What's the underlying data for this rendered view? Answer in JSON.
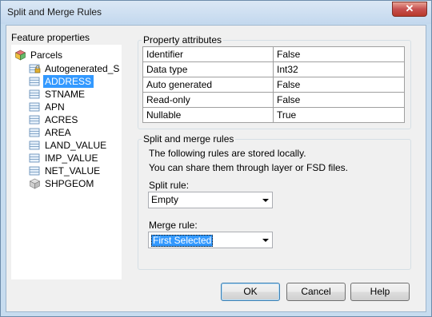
{
  "window": {
    "title": "Split and Merge Rules",
    "close_glyph": "✕"
  },
  "feature_properties": {
    "label": "Feature properties",
    "root": {
      "label": "Parcels",
      "icon": "feature-class-icon"
    },
    "fields": [
      {
        "label": "Autogenerated_S",
        "icon": "locked-field-icon",
        "selected": false
      },
      {
        "label": "ADDRESS",
        "icon": "field-icon",
        "selected": true
      },
      {
        "label": "STNAME",
        "icon": "field-icon",
        "selected": false
      },
      {
        "label": "APN",
        "icon": "field-icon",
        "selected": false
      },
      {
        "label": "ACRES",
        "icon": "field-icon",
        "selected": false
      },
      {
        "label": "AREA",
        "icon": "field-icon",
        "selected": false
      },
      {
        "label": "LAND_VALUE",
        "icon": "field-icon",
        "selected": false
      },
      {
        "label": "IMP_VALUE",
        "icon": "field-icon",
        "selected": false
      },
      {
        "label": "NET_VALUE",
        "icon": "field-icon",
        "selected": false
      },
      {
        "label": "SHPGEOM",
        "icon": "geometry-field-icon",
        "selected": false
      }
    ]
  },
  "property_attributes": {
    "title": "Property attributes",
    "rows": [
      {
        "name": "Identifier",
        "value": "False"
      },
      {
        "name": "Data type",
        "value": "Int32"
      },
      {
        "name": "Auto generated",
        "value": "False"
      },
      {
        "name": "Read-only",
        "value": "False"
      },
      {
        "name": "Nullable",
        "value": "True"
      }
    ]
  },
  "split_merge": {
    "title": "Split and merge rules",
    "line1": "The following rules are stored  locally.",
    "line2": "You can share them through layer or FSD files.",
    "split_label": "Split rule:",
    "split_value": "Empty",
    "merge_label": "Merge rule:",
    "merge_value": "First Selected"
  },
  "buttons": {
    "ok": "OK",
    "cancel": "Cancel",
    "help": "Help"
  },
  "colors": {
    "selection": "#3399ff",
    "frame": "#c7dcef",
    "close": "#c75050"
  }
}
